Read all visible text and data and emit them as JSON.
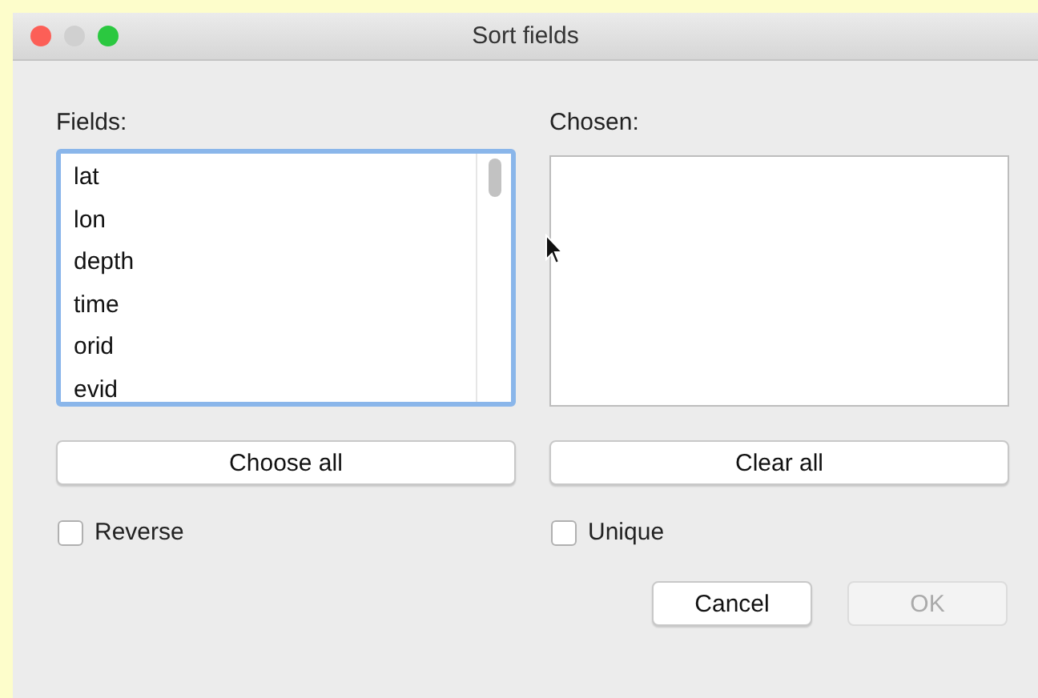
{
  "window": {
    "title": "Sort fields"
  },
  "fields": {
    "label": "Fields:",
    "items": [
      "lat",
      "lon",
      "depth",
      "time",
      "orid",
      "evid"
    ]
  },
  "chosen": {
    "label": "Chosen:"
  },
  "list_buttons": [
    {
      "label": "Choose all"
    },
    {
      "label": "Clear all"
    }
  ],
  "checkboxes": [
    {
      "label": "Reverse",
      "checked": false
    },
    {
      "label": "Unique",
      "checked": false
    }
  ],
  "buttons": [
    {
      "label": "Cancel",
      "disabled": false
    },
    {
      "label": "OK",
      "disabled": true
    }
  ]
}
